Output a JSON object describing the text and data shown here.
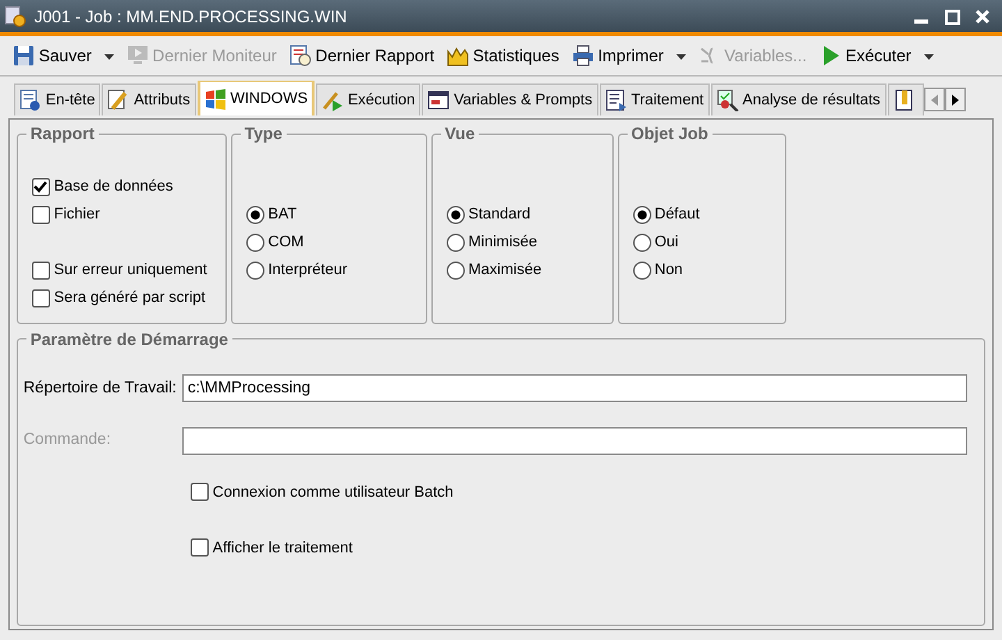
{
  "window": {
    "title": "J001 - Job : MM.END.PROCESSING.WIN"
  },
  "toolbar": [
    {
      "label": "Sauver",
      "disabled": false,
      "dropdown": true
    },
    {
      "label": "Dernier Moniteur",
      "disabled": true,
      "dropdown": false
    },
    {
      "label": "Dernier Rapport",
      "disabled": false,
      "dropdown": false
    },
    {
      "label": "Statistiques",
      "disabled": false,
      "dropdown": false
    },
    {
      "label": "Imprimer",
      "disabled": false,
      "dropdown": true
    },
    {
      "label": "Variables...",
      "disabled": true,
      "dropdown": false
    },
    {
      "label": "Exécuter",
      "disabled": false,
      "dropdown": true
    }
  ],
  "tabs": [
    {
      "label": "En-tête",
      "selected": false
    },
    {
      "label": "Attributs",
      "selected": false
    },
    {
      "label": "WINDOWS",
      "selected": true
    },
    {
      "label": "Exécution",
      "selected": false
    },
    {
      "label": "Variables & Prompts",
      "selected": false
    },
    {
      "label": "Traitement",
      "selected": false
    },
    {
      "label": "Analyse de résultats",
      "selected": false
    },
    {
      "selected": false
    }
  ],
  "groups": [
    {
      "title": "Rapport",
      "kind": "checkbox",
      "options": [
        {
          "label": "Base de données",
          "checked": true
        },
        {
          "label": "Fichier",
          "checked": false
        },
        {
          "label": "Sur erreur uniquement",
          "checked": false
        },
        {
          "label": "Sera généré par script",
          "checked": false
        }
      ]
    },
    {
      "title": "Type",
      "kind": "radio",
      "options": [
        {
          "label": "BAT",
          "selected": true
        },
        {
          "label": "COM",
          "selected": false
        },
        {
          "label": "Interpréteur",
          "selected": false
        }
      ]
    },
    {
      "title": "Vue",
      "kind": "radio",
      "options": [
        {
          "label": "Standard",
          "selected": true
        },
        {
          "label": "Minimisée",
          "selected": false
        },
        {
          "label": "Maximisée",
          "selected": false
        }
      ]
    },
    {
      "title": "Objet Job",
      "kind": "radio",
      "options": [
        {
          "label": "Défaut",
          "selected": true
        },
        {
          "label": "Oui",
          "selected": false
        },
        {
          "label": "Non",
          "selected": false
        }
      ]
    }
  ],
  "startup": {
    "title": "Paramètre de Démarrage",
    "fields": [
      {
        "label": "Répertoire de Travail:",
        "value": "c:\\MMProcessing",
        "disabled": false
      },
      {
        "label": "Commande:",
        "disabled": true
      }
    ],
    "options": [
      {
        "label": "Connexion comme utilisateur Batch",
        "checked": false
      },
      {
        "label": "Afficher le traitement",
        "checked": false
      }
    ]
  }
}
